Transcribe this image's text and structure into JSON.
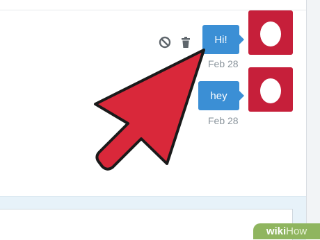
{
  "messages": [
    {
      "text": "Hi!",
      "timestamp": "Feb 28"
    },
    {
      "text": "hey",
      "timestamp": "Feb 28"
    }
  ],
  "actions": {
    "block_icon": "block-icon",
    "delete_icon": "trash-icon"
  },
  "avatar_icon": "egg-avatar-icon",
  "cursor": "arrow-cursor-icon",
  "watermark": {
    "part1": "wiki",
    "part2": "How"
  },
  "colors": {
    "bubble": "#3b8fd5",
    "avatar_bg": "#c61f3a",
    "cursor": "#d9283a",
    "composer": "#e7f2f9"
  }
}
